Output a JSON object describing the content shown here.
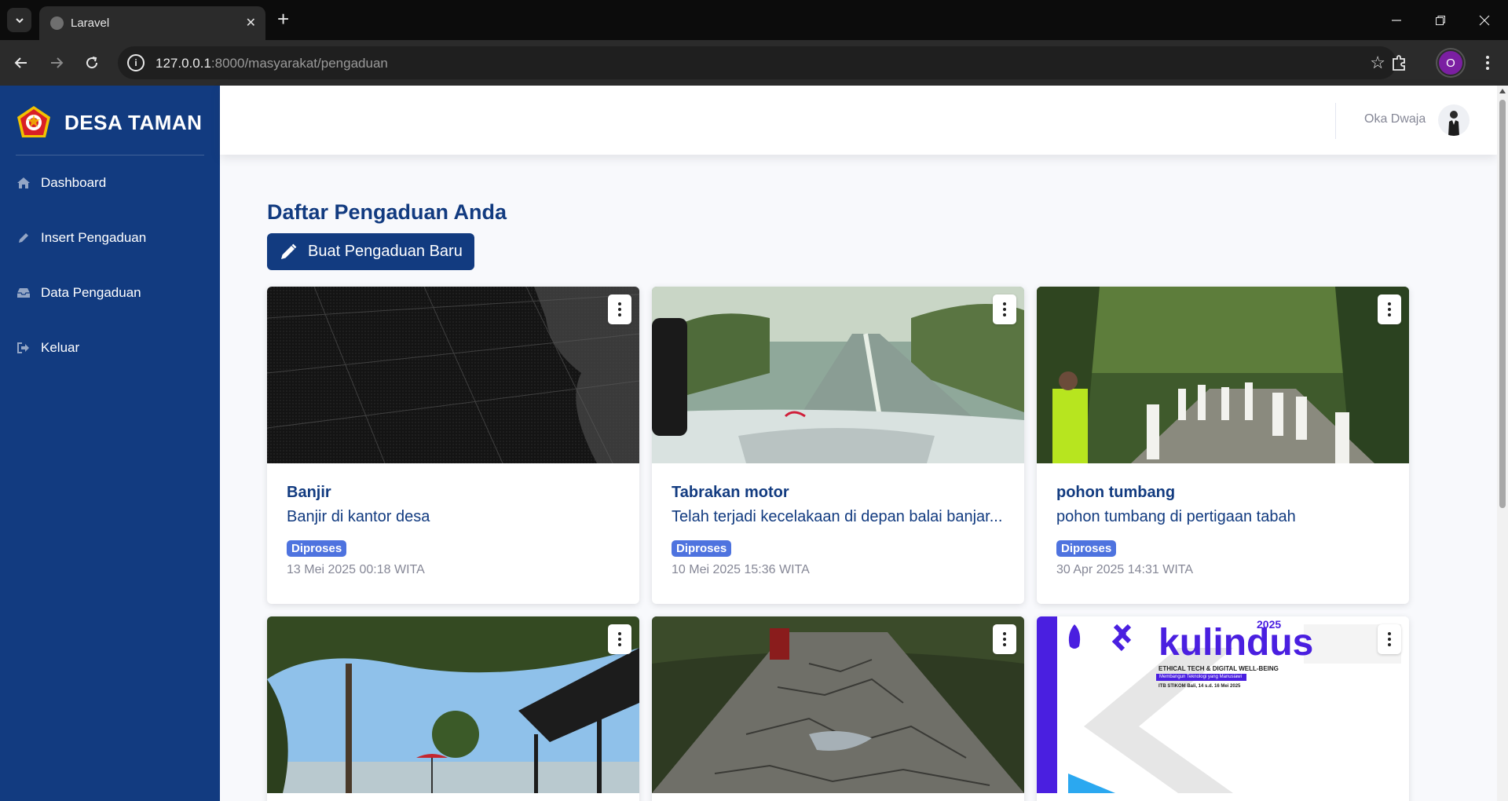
{
  "browser": {
    "tab_title": "Laravel",
    "url_host": "127.0.0.1",
    "url_rest": ":8000/masyarakat/pengaduan",
    "profile_initial": "O"
  },
  "sidebar": {
    "brand": "DESA TAMAN",
    "items": [
      {
        "label": "Dashboard",
        "icon": "home-icon"
      },
      {
        "label": "Insert Pengaduan",
        "icon": "pencil-icon"
      },
      {
        "label": "Data Pengaduan",
        "icon": "inbox-icon"
      },
      {
        "label": "Keluar",
        "icon": "logout-icon"
      }
    ]
  },
  "topbar": {
    "username": "Oka Dwaja"
  },
  "main": {
    "title": "Daftar Pengaduan Anda",
    "new_button_label": "Buat Pengaduan Baru"
  },
  "cards": [
    {
      "title": "Banjir",
      "description": "Banjir di kantor desa",
      "status": "Diproses",
      "date": "13 Mei 2025 00:18 WITA",
      "image": "dark map"
    },
    {
      "title": "Tabrakan motor",
      "description": "Telah terjadi kecelakaan di depan balai banjar...",
      "status": "Diproses",
      "date": "10 Mei 2025 15:36 WITA",
      "image": "road from car dashboard"
    },
    {
      "title": "pohon tumbang",
      "description": "pohon tumbang di pertigaan tabah",
      "status": "Diproses",
      "date": "30 Apr 2025 14:31 WITA",
      "image": "procession on road among trees"
    },
    {
      "title": "",
      "description": "",
      "status": "",
      "date": "",
      "image": "beach with trees and umbrella"
    },
    {
      "title": "",
      "description": "",
      "status": "",
      "date": "",
      "image": "damaged road"
    },
    {
      "title": "",
      "description": "",
      "status": "",
      "date": "",
      "image": "kulindus 2025 poster"
    }
  ],
  "poster": {
    "title": "kulindus",
    "year": "2025",
    "tagline": "ETHICAL TECH & DIGITAL WELL-BEING",
    "subtagline": "Membangun Teknologi yang Manusiawi",
    "event": "ITB STIKOM Bali, 14 s.d. 16 Mei 2025"
  },
  "colors": {
    "sidebar": "#123b80",
    "primary": "#123b80",
    "badge": "#4e73df",
    "muted": "#858796"
  }
}
